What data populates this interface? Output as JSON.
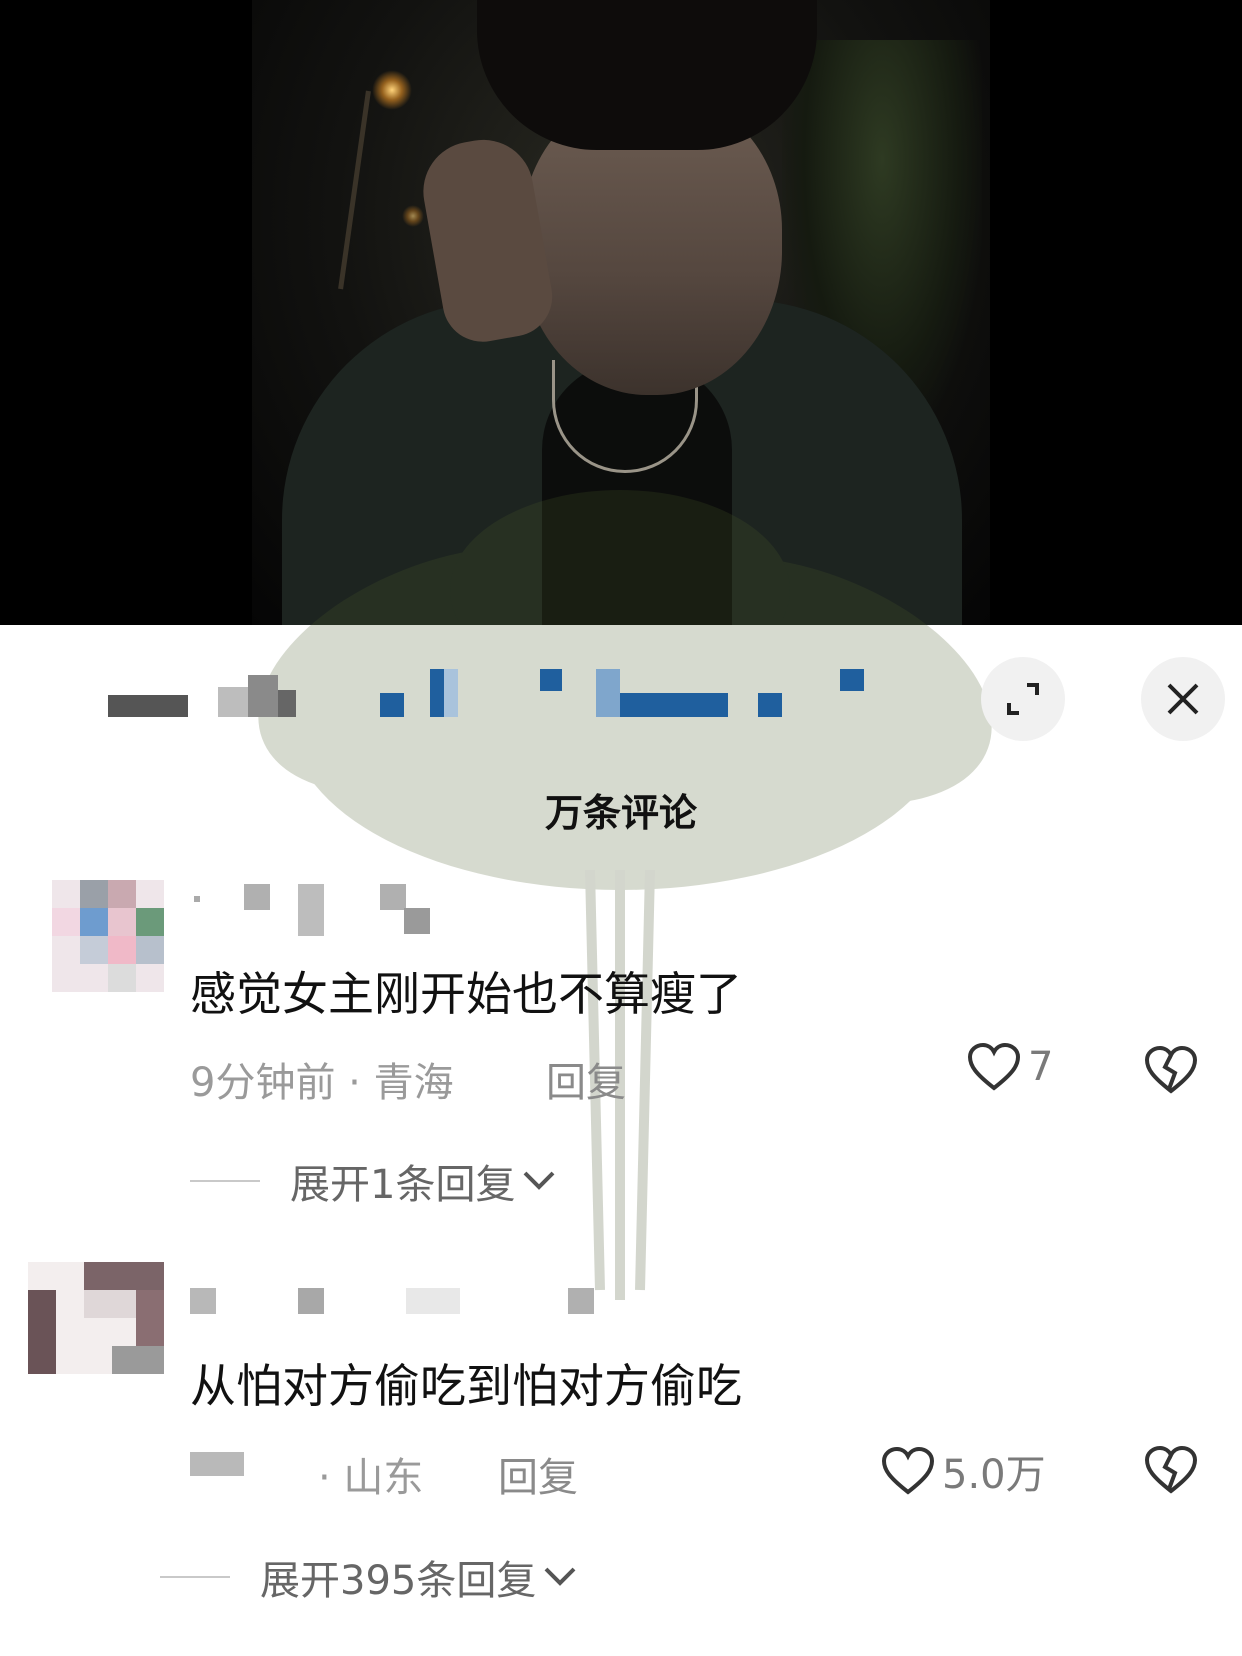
{
  "video": {
    "description_free": true
  },
  "header": {
    "comments_count": "万条评论",
    "expand_icon": "expand-icon",
    "close_icon": "close-icon"
  },
  "comments": [
    {
      "text": "感觉女主刚开始也不算瘦了",
      "time_location": "9分钟前 · 青海",
      "reply_label": "回复",
      "like_count": "7",
      "expand_replies": "展开1条回复"
    },
    {
      "text": "从怕对方偷吃到怕对方偷吃",
      "location": "· 山东",
      "reply_label": "回复",
      "like_count": "5.0万",
      "expand_replies": "展开395条回复"
    }
  ],
  "colors": {
    "background": "#ffffff",
    "text_primary": "#111111",
    "text_secondary": "#9a9a9a",
    "mosaic_blue": "#1f5f9e"
  }
}
